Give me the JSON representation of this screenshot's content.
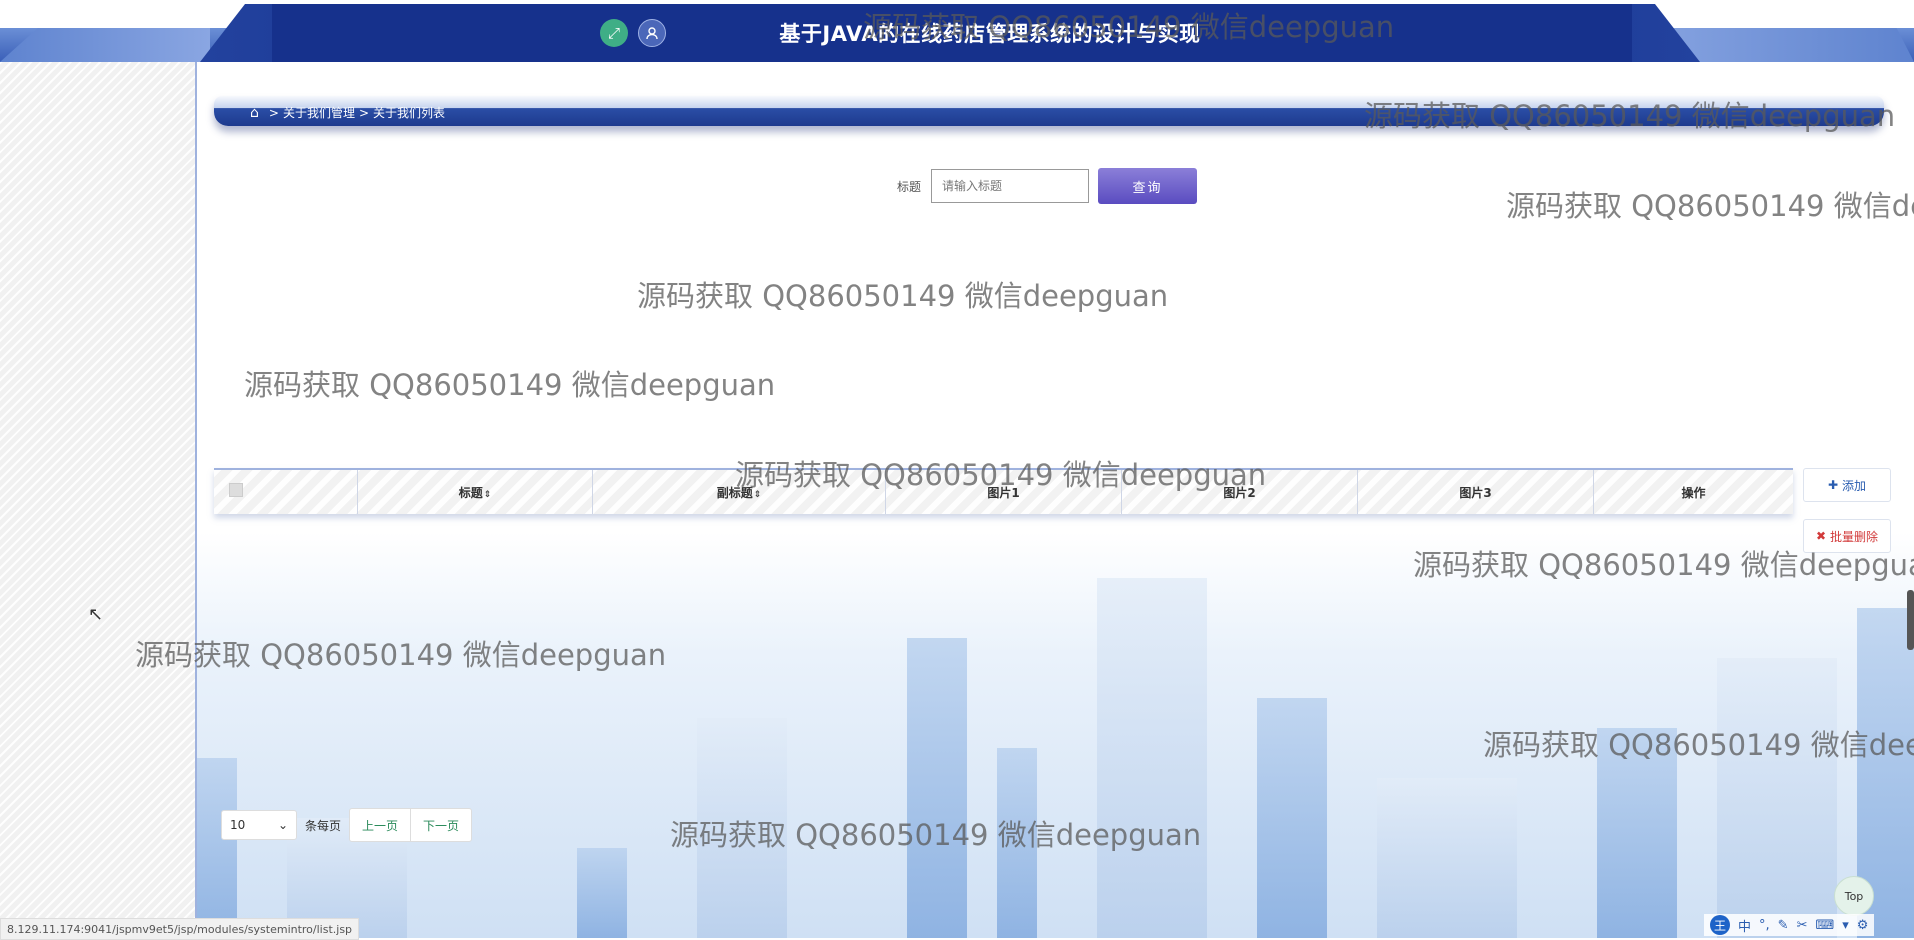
{
  "header": {
    "title": "基于JAVA的在线药店管理系统的设计与实现",
    "fullscreen_icon": "expand-icon",
    "user_icon": "user-icon"
  },
  "breadcrumb": {
    "home_icon": "home-icon",
    "separator": ">",
    "items": [
      "关于我们管理",
      "关于我们列表"
    ]
  },
  "search": {
    "label": "标题",
    "placeholder": "请输入标题",
    "button_label": "查询"
  },
  "table": {
    "columns": [
      {
        "label": "",
        "sortable": false
      },
      {
        "label": "标题",
        "sortable": true
      },
      {
        "label": "副标题",
        "sortable": true
      },
      {
        "label": "图片1",
        "sortable": false
      },
      {
        "label": "图片2",
        "sortable": false
      },
      {
        "label": "图片3",
        "sortable": false
      },
      {
        "label": "操作",
        "sortable": false
      }
    ],
    "rows": []
  },
  "actions": {
    "add_label": "添加",
    "batch_delete_label": "批量删除"
  },
  "pager": {
    "page_size": "10",
    "per_page_label": "条每页",
    "prev_label": "上一页",
    "next_label": "下一页"
  },
  "back_to_top_label": "Top",
  "status_url": "8.129.11.174:9041/jspmv9et5/jsp/modules/systemintro/list.jsp",
  "watermark_text": "源码获取 QQ86050149 微信deepguan",
  "ime_toolbar": {
    "logo": "王",
    "lang": "中",
    "punct": "°,"
  },
  "colors": {
    "header_blue": "#16318c",
    "query_button": "#6a5cc8",
    "add_text": "#2a5db0",
    "delete_text": "#d23a3a",
    "pager_text": "#2a8a5a"
  }
}
